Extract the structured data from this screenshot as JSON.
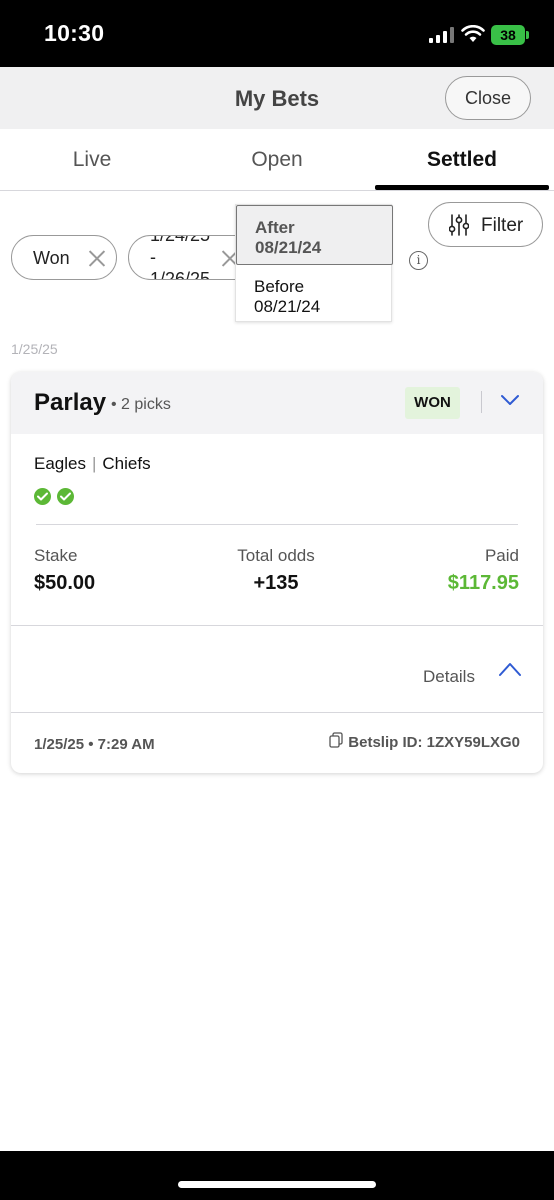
{
  "status_bar": {
    "time": "10:30",
    "battery": "38"
  },
  "header": {
    "title": "My Bets",
    "close_label": "Close"
  },
  "tabs": [
    {
      "label": "Live"
    },
    {
      "label": "Open"
    },
    {
      "label": "Settled",
      "active": true
    }
  ],
  "filters": {
    "chips": [
      {
        "label": "Won"
      },
      {
        "label": "1/24/25\n-\n1/26/25"
      }
    ],
    "date_dropdown": {
      "options": [
        "After\n08/21/24",
        "Before\n08/21/24"
      ],
      "selected": "After\n08/21/24"
    },
    "filter_label": "Filter"
  },
  "date_header": "1/25/25",
  "bet": {
    "type": "Parlay",
    "picks": "• 2 picks",
    "result": "WON",
    "teams": [
      "Eagles",
      "Chiefs"
    ],
    "stake_label": "Stake",
    "stake": "$50.00",
    "odds_label": "Total odds",
    "odds": "+135",
    "paid_label": "Paid",
    "paid": "$117.95",
    "details_label": "Details",
    "placed": "1/25/25 • 7:29 AM",
    "betslip": "Betslip ID: 1ZXY59LXG0"
  },
  "colors": {
    "win_green": "#5cb836",
    "won_badge_bg": "#e3f3dc",
    "chevron_blue": "#2f5bd3"
  }
}
